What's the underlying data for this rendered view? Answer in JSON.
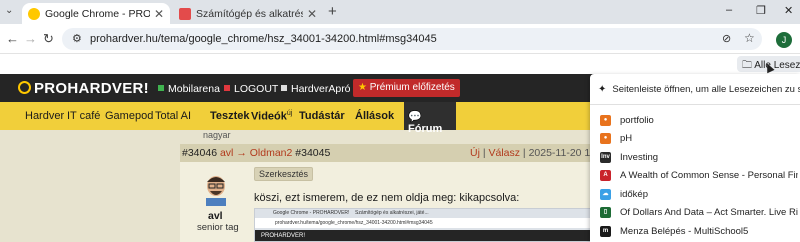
{
  "browser": {
    "tabs": [
      {
        "title": "Google Chrome - PROHARDVER!",
        "active": true
      },
      {
        "title": "Számítógép és alkatrészei, játékok",
        "active": false
      }
    ],
    "new_tab_glyph": "+",
    "window_controls": {
      "minimize": "–",
      "restore": "❐",
      "close": "✕"
    },
    "url": "prohardver.hu/tema/google_chrome/hsz_34001-34200.html#msg34045",
    "profile_initial": "J",
    "bookmarks_bar": {
      "all_bookmarks_label": "Alle Lesezeichen"
    }
  },
  "site": {
    "logo": "PROHARDVER!",
    "top_links": [
      "Mobilarena",
      "LOGOUT",
      "HardverApró"
    ],
    "premium_label": "Prémium előfizetés",
    "nav": [
      "Hardver",
      "IT café",
      "Gamepod",
      "Total AI",
      "Tesztek",
      "Videók",
      "Tudástár",
      "Állások",
      "Fórum"
    ],
    "videos_suffix": "új",
    "left_label": "nagyar",
    "post": {
      "id": "#34046",
      "author": "avl",
      "arrow": "→",
      "reply_to": "Oldman2",
      "reply_id": "#34045",
      "new_label": "Új",
      "reply_label": "Válasz",
      "date": "2025-11-20 14:02",
      "username": "avl",
      "rank": "senior tag",
      "edit_badge": "Szerkesztés",
      "text": "köszi, ezt ismerem, de ez nem oldja meg: kikapcsolva:",
      "inner": {
        "tab1": "Google Chrome - PROHARDVER!",
        "tab2": "Számítógép és alkatrészei, játé...",
        "url": "prohardver.hu/tema/google_chrome/hsz_34001-34200.html#msg34045",
        "logo": "PROHARDVER!"
      }
    }
  },
  "bookmarks_panel": {
    "top_label": "Seitenleiste öffnen, um alle Lesezeichen zu sehen",
    "items": [
      {
        "label": "portfolio",
        "icon": "portfolio-icon",
        "color": "#e8731d"
      },
      {
        "label": "pH",
        "icon": "ph-icon",
        "color": "#e8731d"
      },
      {
        "label": "Investing",
        "icon": "investing-icon",
        "color": "#2b2b2b"
      },
      {
        "label": "A Wealth of Common Sense - Personal Finance, Inv...",
        "icon": "wealth-icon",
        "color": "#c9232b"
      },
      {
        "label": "időkép",
        "icon": "cloud-icon",
        "color": "#3aa0e6"
      },
      {
        "label": "Of Dollars And Data – Act Smarter. Live Richer.",
        "icon": "dollars-data-icon",
        "color": "#1d6b35"
      },
      {
        "label": "Menza Belépés - MultiSchool5",
        "icon": "menza-icon",
        "color": "#1a1a1a"
      }
    ]
  },
  "colors": {
    "site_nav_yellow": "#f1cf3a",
    "site_header_dark": "#252525",
    "premium_red": "#c12a2a",
    "page_beige": "#e7e3cf"
  }
}
